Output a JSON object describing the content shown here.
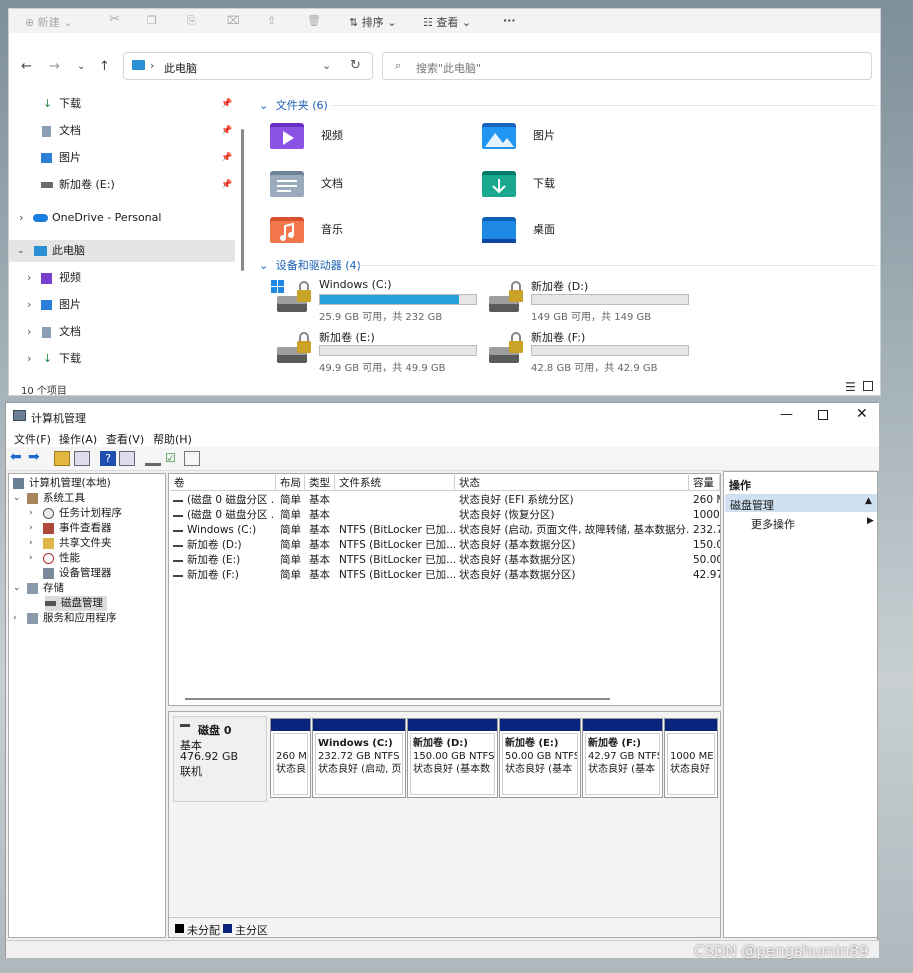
{
  "explorer": {
    "cmd": {
      "new": "新建",
      "sort": "排序",
      "view": "查看",
      "more": "···"
    },
    "address": {
      "path": "此电脑",
      "search_placeholder": "搜索\"此电脑\""
    },
    "nav": [
      {
        "label": "下载",
        "icon": "download-icon"
      },
      {
        "label": "文档",
        "icon": "document-icon"
      },
      {
        "label": "图片",
        "icon": "picture-icon"
      },
      {
        "label": "新加卷 (E:)",
        "icon": "drive-icon"
      },
      {
        "label": "OneDrive - Personal",
        "icon": "cloud-icon"
      },
      {
        "label": "此电脑",
        "icon": "computer-icon"
      },
      {
        "label": "视频",
        "icon": "video-icon"
      },
      {
        "label": "图片",
        "icon": "picture-icon"
      },
      {
        "label": "文档",
        "icon": "document-icon"
      },
      {
        "label": "下载",
        "icon": "download-icon"
      }
    ],
    "folders_header": "文件夹 (6)",
    "folders": [
      {
        "label": "视频",
        "icon": "video-folder-icon"
      },
      {
        "label": "图片",
        "icon": "picture-folder-icon"
      },
      {
        "label": "文档",
        "icon": "document-folder-icon"
      },
      {
        "label": "下载",
        "icon": "download-folder-icon"
      },
      {
        "label": "音乐",
        "icon": "music-folder-icon"
      },
      {
        "label": "桌面",
        "icon": "desktop-folder-icon"
      }
    ],
    "drives_header": "设备和驱动器 (4)",
    "drives": [
      {
        "name": "Windows (C:)",
        "cap": "25.9 GB 可用，共 232 GB",
        "used_fraction": 0.89
      },
      {
        "name": "新加卷 (D:)",
        "cap": "149 GB 可用，共 149 GB",
        "used_fraction": 0.0
      },
      {
        "name": "新加卷 (E:)",
        "cap": "49.9 GB 可用，共 49.9 GB",
        "used_fraction": 0.0
      },
      {
        "name": "新加卷 (F:)",
        "cap": "42.8 GB 可用，共 42.9 GB",
        "used_fraction": 0.0
      }
    ],
    "status": "10 个项目"
  },
  "mmc": {
    "title": "计算机管理",
    "menu": [
      "文件(F)",
      "操作(A)",
      "查看(V)",
      "帮助(H)"
    ],
    "tree": [
      {
        "label": "计算机管理(本地)"
      },
      {
        "label": "系统工具"
      },
      {
        "label": "任务计划程序"
      },
      {
        "label": "事件查看器"
      },
      {
        "label": "共享文件夹"
      },
      {
        "label": "性能"
      },
      {
        "label": "设备管理器"
      },
      {
        "label": "存储"
      },
      {
        "label": "磁盘管理"
      },
      {
        "label": "服务和应用程序"
      }
    ],
    "columns": [
      "卷",
      "布局",
      "类型",
      "文件系统",
      "状态",
      "容量"
    ],
    "rows": [
      [
        "(磁盘 0 磁盘分区 ...",
        "简单",
        "基本",
        "",
        "状态良好 (EFI 系统分区)",
        "260 M"
      ],
      [
        "(磁盘 0 磁盘分区 ...",
        "简单",
        "基本",
        "",
        "状态良好 (恢复分区)",
        "1000"
      ],
      [
        "Windows (C:)",
        "简单",
        "基本",
        "NTFS (BitLocker 已加...",
        "状态良好 (启动, 页面文件, 故障转储, 基本数据分...",
        "232.7"
      ],
      [
        "新加卷 (D:)",
        "简单",
        "基本",
        "NTFS (BitLocker 已加...",
        "状态良好 (基本数据分区)",
        "150.0"
      ],
      [
        "新加卷 (E:)",
        "简单",
        "基本",
        "NTFS (BitLocker 已加...",
        "状态良好 (基本数据分区)",
        "50.00"
      ],
      [
        "新加卷 (F:)",
        "简单",
        "基本",
        "NTFS (BitLocker 已加...",
        "状态良好 (基本数据分区)",
        "42.97"
      ]
    ],
    "disk": {
      "name": "磁盘 0",
      "type": "基本",
      "size": "476.92 GB",
      "state": "联机"
    },
    "parts": [
      {
        "title": "",
        "size": "260 M",
        "status": "状态良"
      },
      {
        "title": "Windows  (C:)",
        "size": "232.72 GB NTFS",
        "status": "状态良好 (启动, 页"
      },
      {
        "title": "新加卷  (D:)",
        "size": "150.00 GB NTFS",
        "status": "状态良好 (基本数"
      },
      {
        "title": "新加卷  (E:)",
        "size": "50.00 GB NTFS",
        "status": "状态良好 (基本"
      },
      {
        "title": "新加卷  (F:)",
        "size": "42.97 GB NTFS",
        "status": "状态良好 (基本"
      },
      {
        "title": "",
        "size": "1000 ME",
        "status": "状态良好"
      }
    ],
    "legend": {
      "unalloc": "未分配",
      "primary": "主分区"
    },
    "actions": {
      "header": "操作",
      "section": "磁盘管理",
      "more": "更多操作"
    }
  },
  "watermark": "CSDN @pengshumin89"
}
